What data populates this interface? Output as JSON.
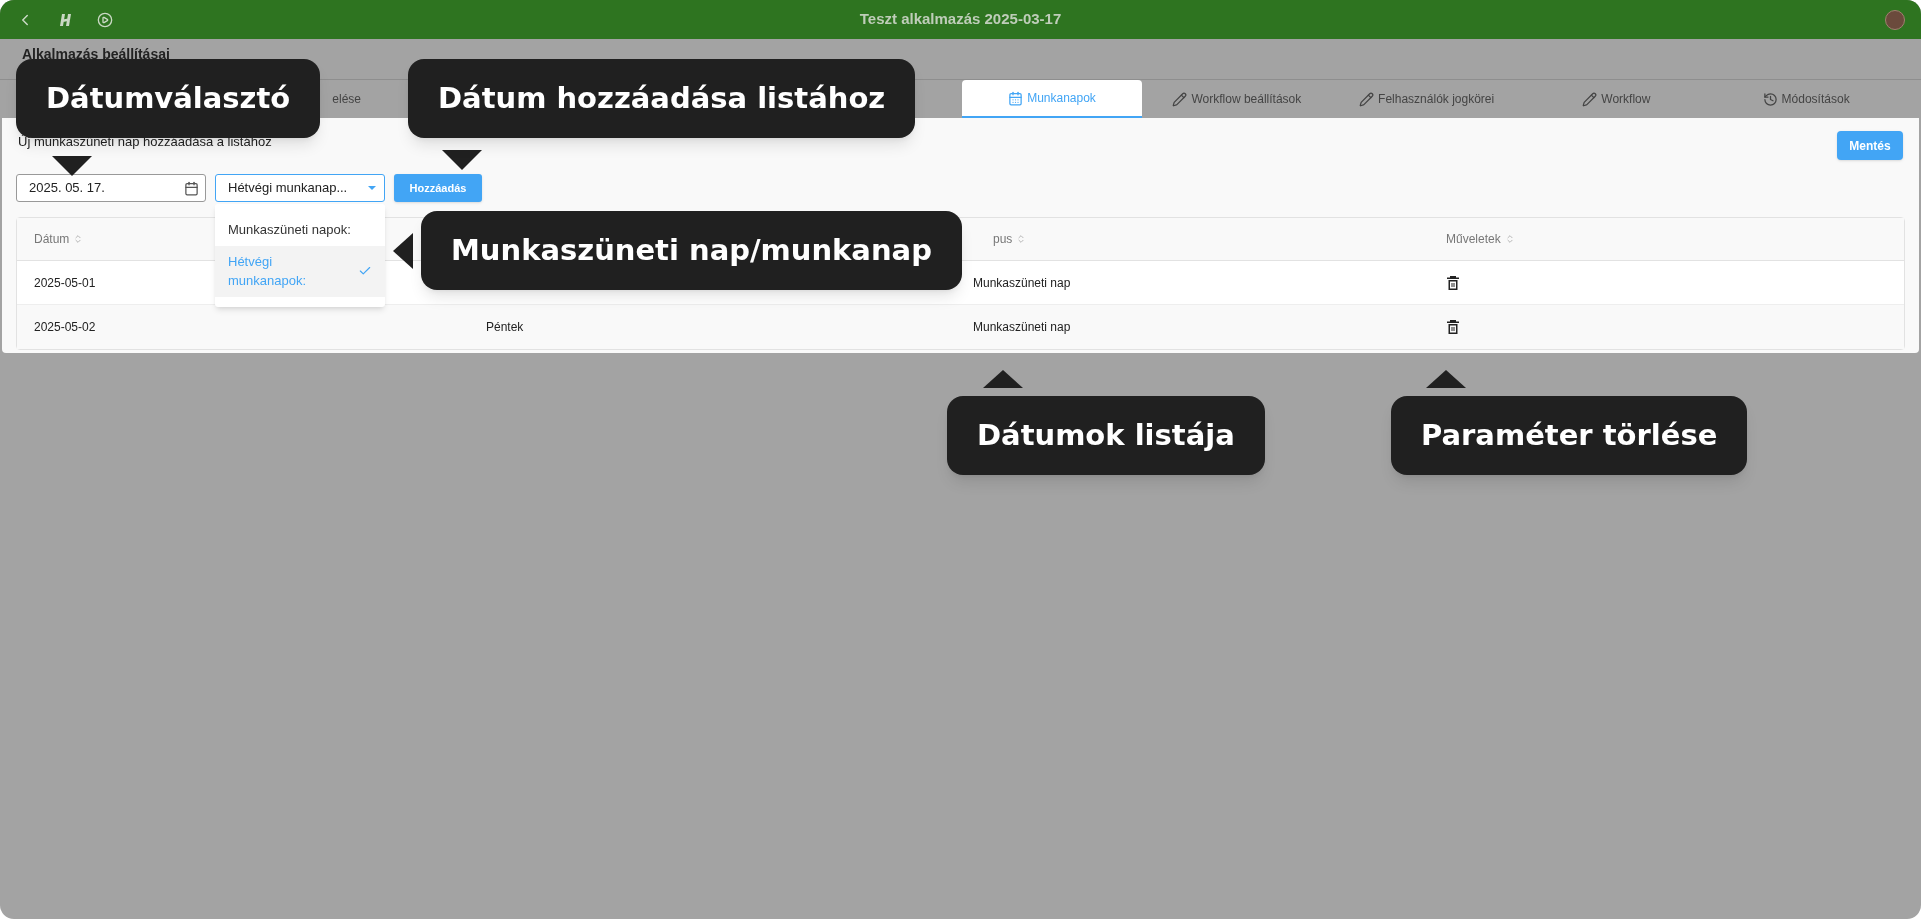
{
  "window": {
    "title": "Teszt alkalmazás 2025-03-17"
  },
  "page_title": "Alkalmazás beállításai",
  "tabs": [
    {
      "label": "elése",
      "kind": "plain",
      "selected": false
    },
    {
      "label": "Munkanapok",
      "kind": "schedule",
      "selected": true
    },
    {
      "label": "Workflow beállítások",
      "kind": "edit",
      "selected": false
    },
    {
      "label": "Felhasználók jogkörei",
      "kind": "edit",
      "selected": false
    },
    {
      "label": "Workflow",
      "kind": "edit",
      "selected": false
    },
    {
      "label": "Módosítások",
      "kind": "history",
      "selected": false
    }
  ],
  "panel": {
    "heading": "Új munkaszüneti nap hozzáadása a listához",
    "save_button": "Mentés",
    "date_field": {
      "value": "2025. 05. 17."
    },
    "type_select": {
      "value": "Hétvégi munkanap...",
      "expanded": true,
      "options": [
        {
          "label": "Munkaszüneti napok:",
          "selected": false
        },
        {
          "label": "Hétvégi munkanapok:",
          "selected": true
        }
      ]
    },
    "add_button": "Hozzáadás",
    "table": {
      "headers": {
        "date": "Dátum",
        "type": "pus",
        "actions": "Műveletek"
      },
      "rows": [
        {
          "date": "2025-05-01",
          "type": "Munkaszüneti nap"
        },
        {
          "date": "2025-05-02",
          "day": "Péntek",
          "type": "Munkaszüneti nap"
        }
      ]
    }
  },
  "callouts": [
    {
      "text": "Dátumválasztó",
      "kind": "down"
    },
    {
      "text": "Dátum hozzáadása listához",
      "kind": "down"
    },
    {
      "text": "Munkaszüneti nap/munkanap",
      "kind": "left"
    },
    {
      "text": "Dátumok listája",
      "kind": "up"
    },
    {
      "text": "Paraméter törlése",
      "kind": "up"
    }
  ]
}
